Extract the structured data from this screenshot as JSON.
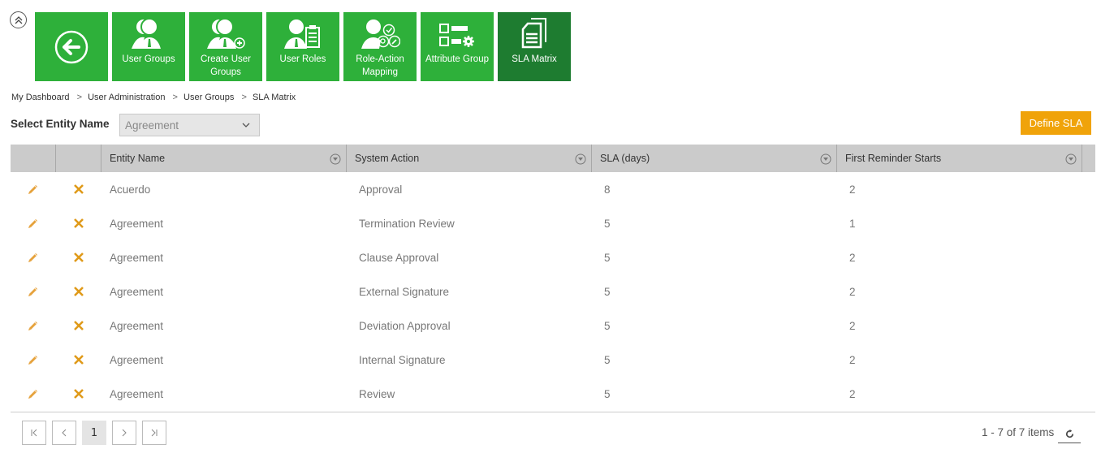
{
  "toolbar": {
    "tiles": [
      {
        "id": "back",
        "label": "",
        "icon": "back-arrow-icon",
        "active": false
      },
      {
        "id": "user-groups",
        "label": "User Groups",
        "icon": "user-group-icon",
        "active": false
      },
      {
        "id": "create-user-groups",
        "label": "Create User Groups",
        "icon": "create-user-group-icon",
        "active": false
      },
      {
        "id": "user-roles",
        "label": "User Roles",
        "icon": "user-roles-icon",
        "active": false
      },
      {
        "id": "role-action-mapping",
        "label": "Role-Action Mapping",
        "icon": "role-action-icon",
        "active": false
      },
      {
        "id": "attribute-group",
        "label": "Attribute Group",
        "icon": "attribute-group-icon",
        "active": false
      },
      {
        "id": "sla-matrix",
        "label": "SLA Matrix",
        "icon": "documents-icon",
        "active": true
      }
    ],
    "colors": {
      "tile": "#2eb03a",
      "tile_active": "#1e7c30"
    }
  },
  "breadcrumb": [
    "My Dashboard",
    "User Administration",
    "User Groups",
    "SLA Matrix"
  ],
  "breadcrumb_sep": ">",
  "filter": {
    "label": "Select Entity Name",
    "selected": "Agreement"
  },
  "actions": {
    "define_sla": "Define SLA",
    "accent": "#f0a30a"
  },
  "table": {
    "columns": [
      "",
      "",
      "Entity Name",
      "System Action",
      "SLA (days)",
      "First Reminder Starts"
    ],
    "rows": [
      {
        "entity": "Acuerdo",
        "action": "Approval",
        "sla": "8",
        "reminder": "2"
      },
      {
        "entity": "Agreement",
        "action": "Termination Review",
        "sla": "5",
        "reminder": "1"
      },
      {
        "entity": "Agreement",
        "action": "Clause Approval",
        "sla": "5",
        "reminder": "2"
      },
      {
        "entity": "Agreement",
        "action": "External Signature",
        "sla": "5",
        "reminder": "2"
      },
      {
        "entity": "Agreement",
        "action": "Deviation Approval",
        "sla": "5",
        "reminder": "2"
      },
      {
        "entity": "Agreement",
        "action": "Internal Signature",
        "sla": "5",
        "reminder": "2"
      },
      {
        "entity": "Agreement",
        "action": "Review",
        "sla": "5",
        "reminder": "2"
      }
    ]
  },
  "pager": {
    "first": "|<",
    "prev": "<",
    "current": "1",
    "next": ">",
    "last": ">|",
    "info": "1 - 7 of 7 items"
  }
}
